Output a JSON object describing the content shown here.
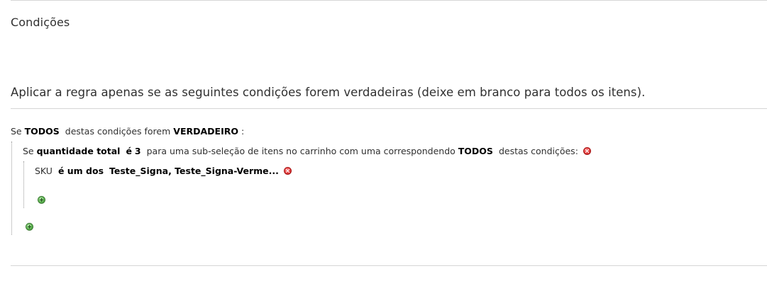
{
  "section": {
    "title": "Condições",
    "legend": "Aplicar a regra apenas se as seguintes condições forem verdadeiras (deixe em branco para todos os itens)."
  },
  "root_condition": {
    "prefix": "Se",
    "aggregator": "TODOS",
    "middle": "destas condições forem",
    "value": "VERDADEIRO",
    "suffix": ":"
  },
  "subselect_condition": {
    "prefix": "Se",
    "attribute": "quantidade total",
    "operator": "é",
    "value": "3",
    "middle": "para uma sub-seleção de itens no carrinho com uma correspondendo",
    "aggregator": "TODOS",
    "suffix": "destas condições:",
    "remove_icon": "remove-icon"
  },
  "product_condition": {
    "attribute": "SKU",
    "operator": "é um dos",
    "value": "Teste_Signa, Teste_Signa-Verme...",
    "remove_icon": "remove-icon"
  },
  "actions": {
    "add_icon": "add-icon"
  },
  "colors": {
    "remove": "#e23b3b",
    "add": "#5fb552",
    "rule": "#d6d6d6",
    "text": "#303030"
  }
}
